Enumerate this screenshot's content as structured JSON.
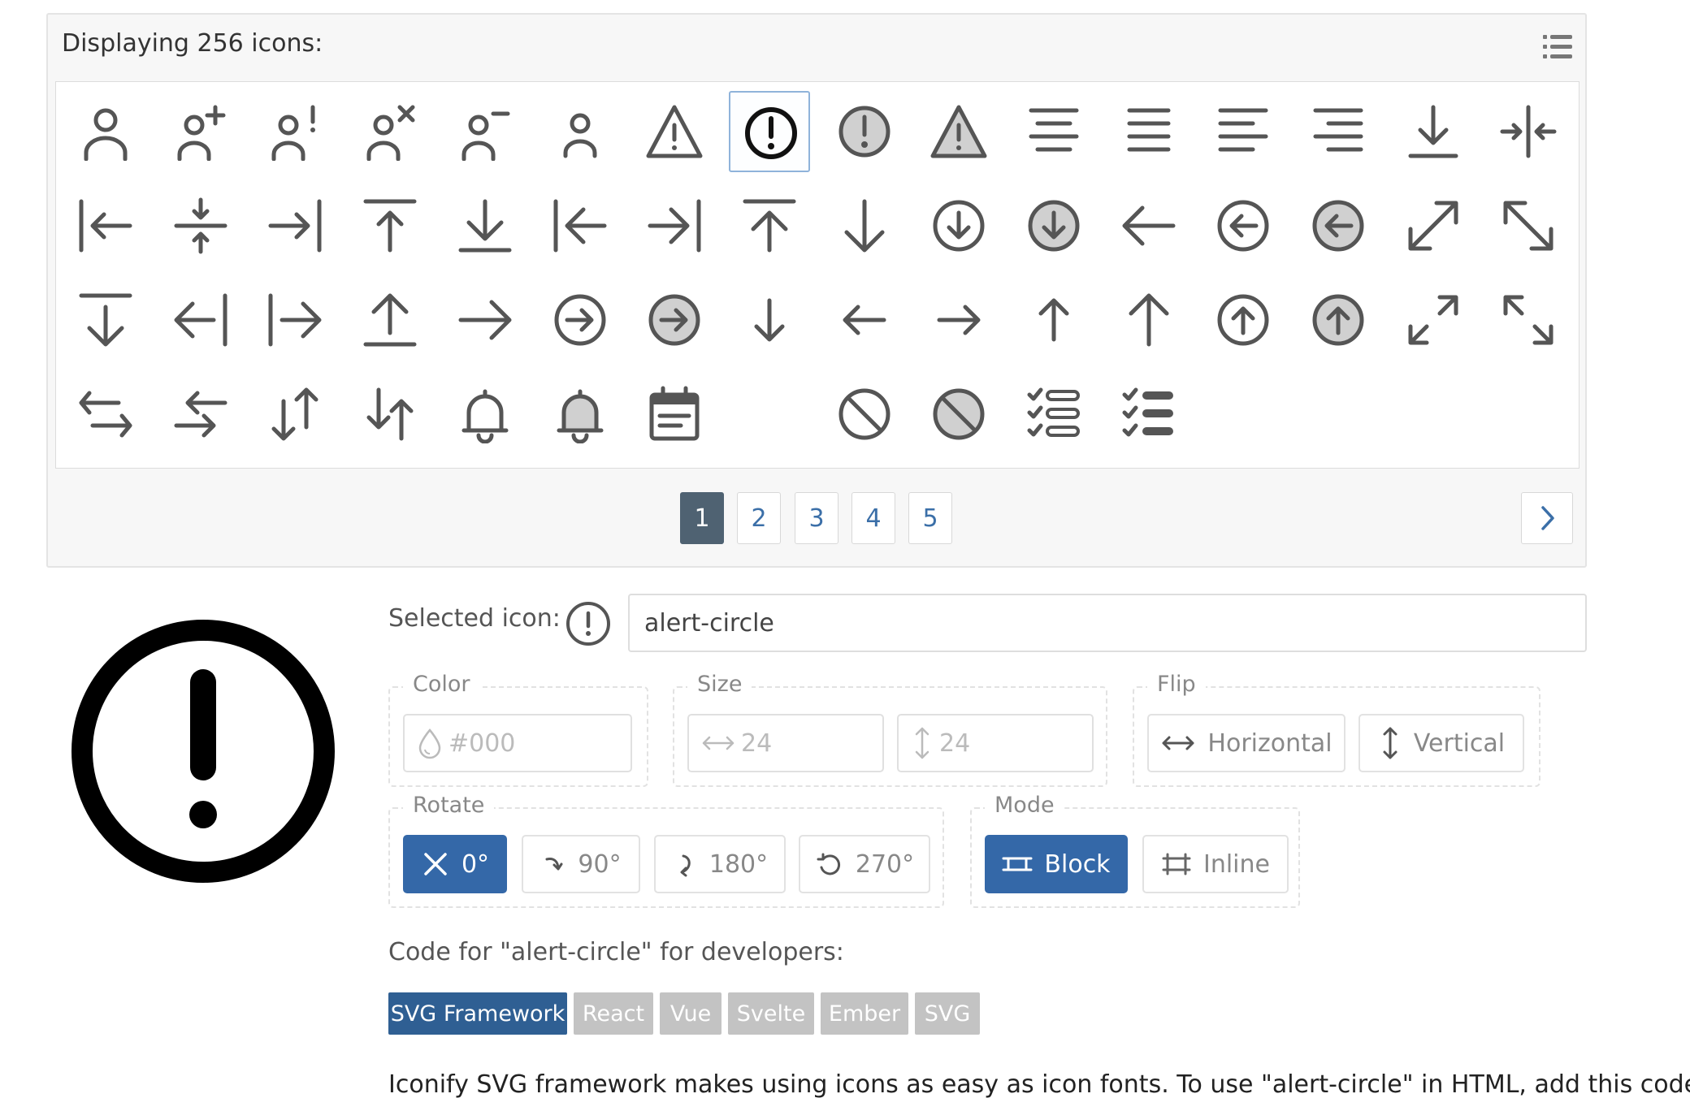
{
  "panel": {
    "title": "Displaying 256 icons:"
  },
  "icon_grid": {
    "icons": [
      "user-icon",
      "user-plus-icon",
      "user-exclamation-icon",
      "user-x-icon",
      "user-minus-icon",
      "user-small-icon",
      "alert-triangle-icon",
      "alert-circle-icon",
      "alert-circle-filled-icon",
      "alert-triangle-filled-icon",
      "align-center-icon",
      "align-justify-icon",
      "align-left-icon",
      "align-right-icon",
      "arrow-bar-down-icon",
      "arrows-collapse-horizontal-icon",
      "arrow-bar-left-icon",
      "arrows-collapse-vertical-icon",
      "arrow-bar-right-icon",
      "arrow-bar-up-icon",
      "arrow-to-bottom-icon",
      "arrow-to-left-icon",
      "arrow-to-right-icon",
      "arrow-to-top-icon",
      "arrow-down-icon",
      "arrow-down-circle-icon",
      "arrow-down-circle-filled-icon",
      "arrow-left-icon",
      "arrow-left-circle-icon",
      "arrow-left-circle-filled-icon",
      "arrow-expand-icon",
      "arrow-expand-alt-icon",
      "arrow-from-top-icon",
      "arrow-from-right-icon",
      "arrow-from-left-icon",
      "arrow-from-bottom-icon",
      "arrow-right-icon",
      "arrow-right-circle-icon",
      "arrow-right-circle-filled-icon",
      "arrow-down-small-icon",
      "arrow-left-small-icon",
      "arrow-right-small-icon",
      "arrow-up-small-icon",
      "arrow-up-icon",
      "arrow-up-circle-icon",
      "arrow-up-circle-filled-icon",
      "arrows-expand-icon",
      "arrows-expand-alt-icon",
      "arrows-horizontal-icon",
      "arrows-left-right-icon",
      "arrows-down-up-icon",
      "arrows-up-down-icon",
      "bell-icon",
      "bell-filled-icon",
      "calendar-icon",
      "",
      "ban-icon",
      "ban-filled-icon",
      "checklist-icon",
      "checklist-filled-icon"
    ]
  },
  "pagination": {
    "pages": [
      "1",
      "2",
      "3",
      "4",
      "5"
    ],
    "active": "1"
  },
  "selected": {
    "label": "Selected icon:",
    "name": "alert-circle",
    "icon": "alert-circle-icon"
  },
  "options": {
    "color": {
      "legend": "Color",
      "placeholder": "#000"
    },
    "size": {
      "legend": "Size",
      "width_placeholder": "24",
      "height_placeholder": "24"
    },
    "flip": {
      "legend": "Flip",
      "horizontal": "Horizontal",
      "vertical": "Vertical"
    },
    "rotate": {
      "legend": "Rotate",
      "r0": "0°",
      "r90": "90°",
      "r180": "180°",
      "r270": "270°",
      "active": "0°"
    },
    "mode": {
      "legend": "Mode",
      "block": "Block",
      "inline": "Inline",
      "active": "Block"
    }
  },
  "code": {
    "title": "Code for \"alert-circle\" for developers:",
    "tabs": [
      "SVG Framework",
      "React",
      "Vue",
      "Svelte",
      "Ember",
      "SVG"
    ],
    "active_tab": "SVG Framework",
    "description": "Iconify SVG framework makes using icons as easy as icon fonts. To use \"alert-circle\" in HTML, add this code"
  },
  "colors": {
    "icon_gray": "#555555",
    "icon_fill_gray": "#d0d0d0",
    "primary_blue": "#3468a8",
    "tab_active": "#2f5f93",
    "tab_inactive": "#c3c3c3",
    "page_active": "#4f6272",
    "selected_border": "#8fb3da"
  }
}
